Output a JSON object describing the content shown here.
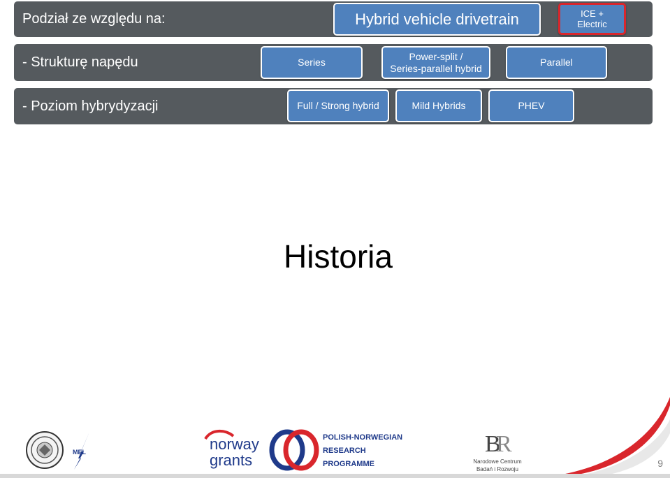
{
  "header": {
    "label": "Podział ze względu na:",
    "title": "Hybrid vehicle drivetrain",
    "badge_line1": "ICE +",
    "badge_line2": "Electric"
  },
  "row_structure": {
    "label": "- Strukturę napędu",
    "items": [
      "Series",
      "Power-split  /",
      "Series-parallel hybrid",
      "Parallel"
    ]
  },
  "row_level": {
    "label": "- Poziom hybrydyzacji",
    "items": [
      "Full / Strong  hybrid",
      "Mild Hybrids",
      "PHEV"
    ]
  },
  "main": {
    "heading": "Historia"
  },
  "footer": {
    "norway_line1": "norway",
    "norway_line2": "grants",
    "pnrp_line1": "POLISH-NORWEGIAN",
    "pnrp_line2": "RESEARCH",
    "pnrp_line3": "PROGRAMME",
    "ncbr_line1": "Narodowe Centrum",
    "ncbr_line2": "Badań i Rozwoju",
    "mel": "MEL",
    "page_number": "9"
  },
  "colors": {
    "bar": "#555a5e",
    "pill": "#4f81bd",
    "badge_border": "#d9262c",
    "accent_red": "#d9262c"
  }
}
